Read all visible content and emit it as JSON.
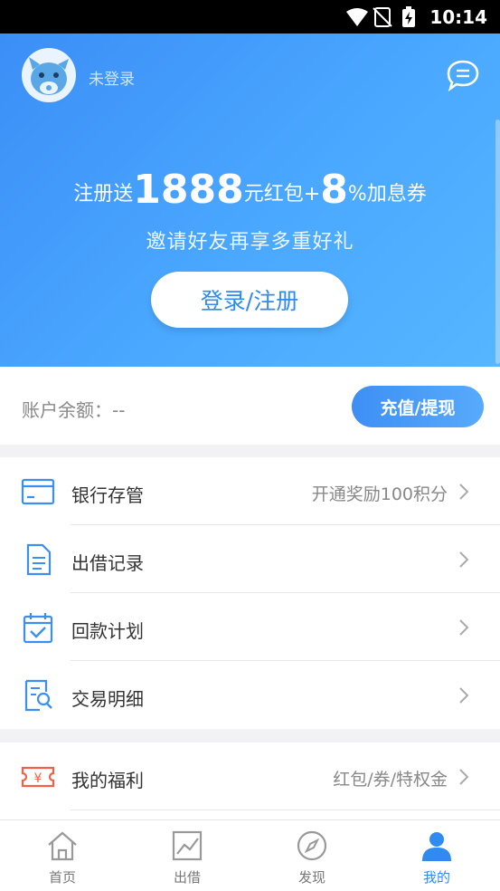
{
  "status_bar": {
    "time": "10:14"
  },
  "header": {
    "login_status": "未登录"
  },
  "promo": {
    "prefix": "注册送",
    "amount": "1888",
    "mid": "元红包+",
    "rate": "8",
    "suffix": "%加息券",
    "subtitle": "邀请好友再享多重好礼",
    "login_button": "登录/注册"
  },
  "account": {
    "balance_label": "账户余额：--",
    "recharge_button": "充值/提现"
  },
  "menu": [
    {
      "label": "银行存管",
      "hint": "开通奖励100积分",
      "icon": "bank-card-icon"
    },
    {
      "label": "出借记录",
      "hint": "",
      "icon": "document-icon"
    },
    {
      "label": "回款计划",
      "hint": "",
      "icon": "calendar-check-icon"
    },
    {
      "label": "交易明细",
      "hint": "",
      "icon": "search-document-icon"
    }
  ],
  "menu2": [
    {
      "label": "我的福利",
      "hint": "红包/券/特权金",
      "icon": "coupon-icon"
    }
  ],
  "tabs": [
    {
      "label": "首页",
      "icon": "home-icon"
    },
    {
      "label": "出借",
      "icon": "chart-icon"
    },
    {
      "label": "发现",
      "icon": "compass-icon"
    },
    {
      "label": "我的",
      "icon": "user-icon"
    }
  ],
  "colors": {
    "primary": "#3b8ef6",
    "active_tab": "#2f8bf0",
    "coupon": "#f0614a"
  }
}
